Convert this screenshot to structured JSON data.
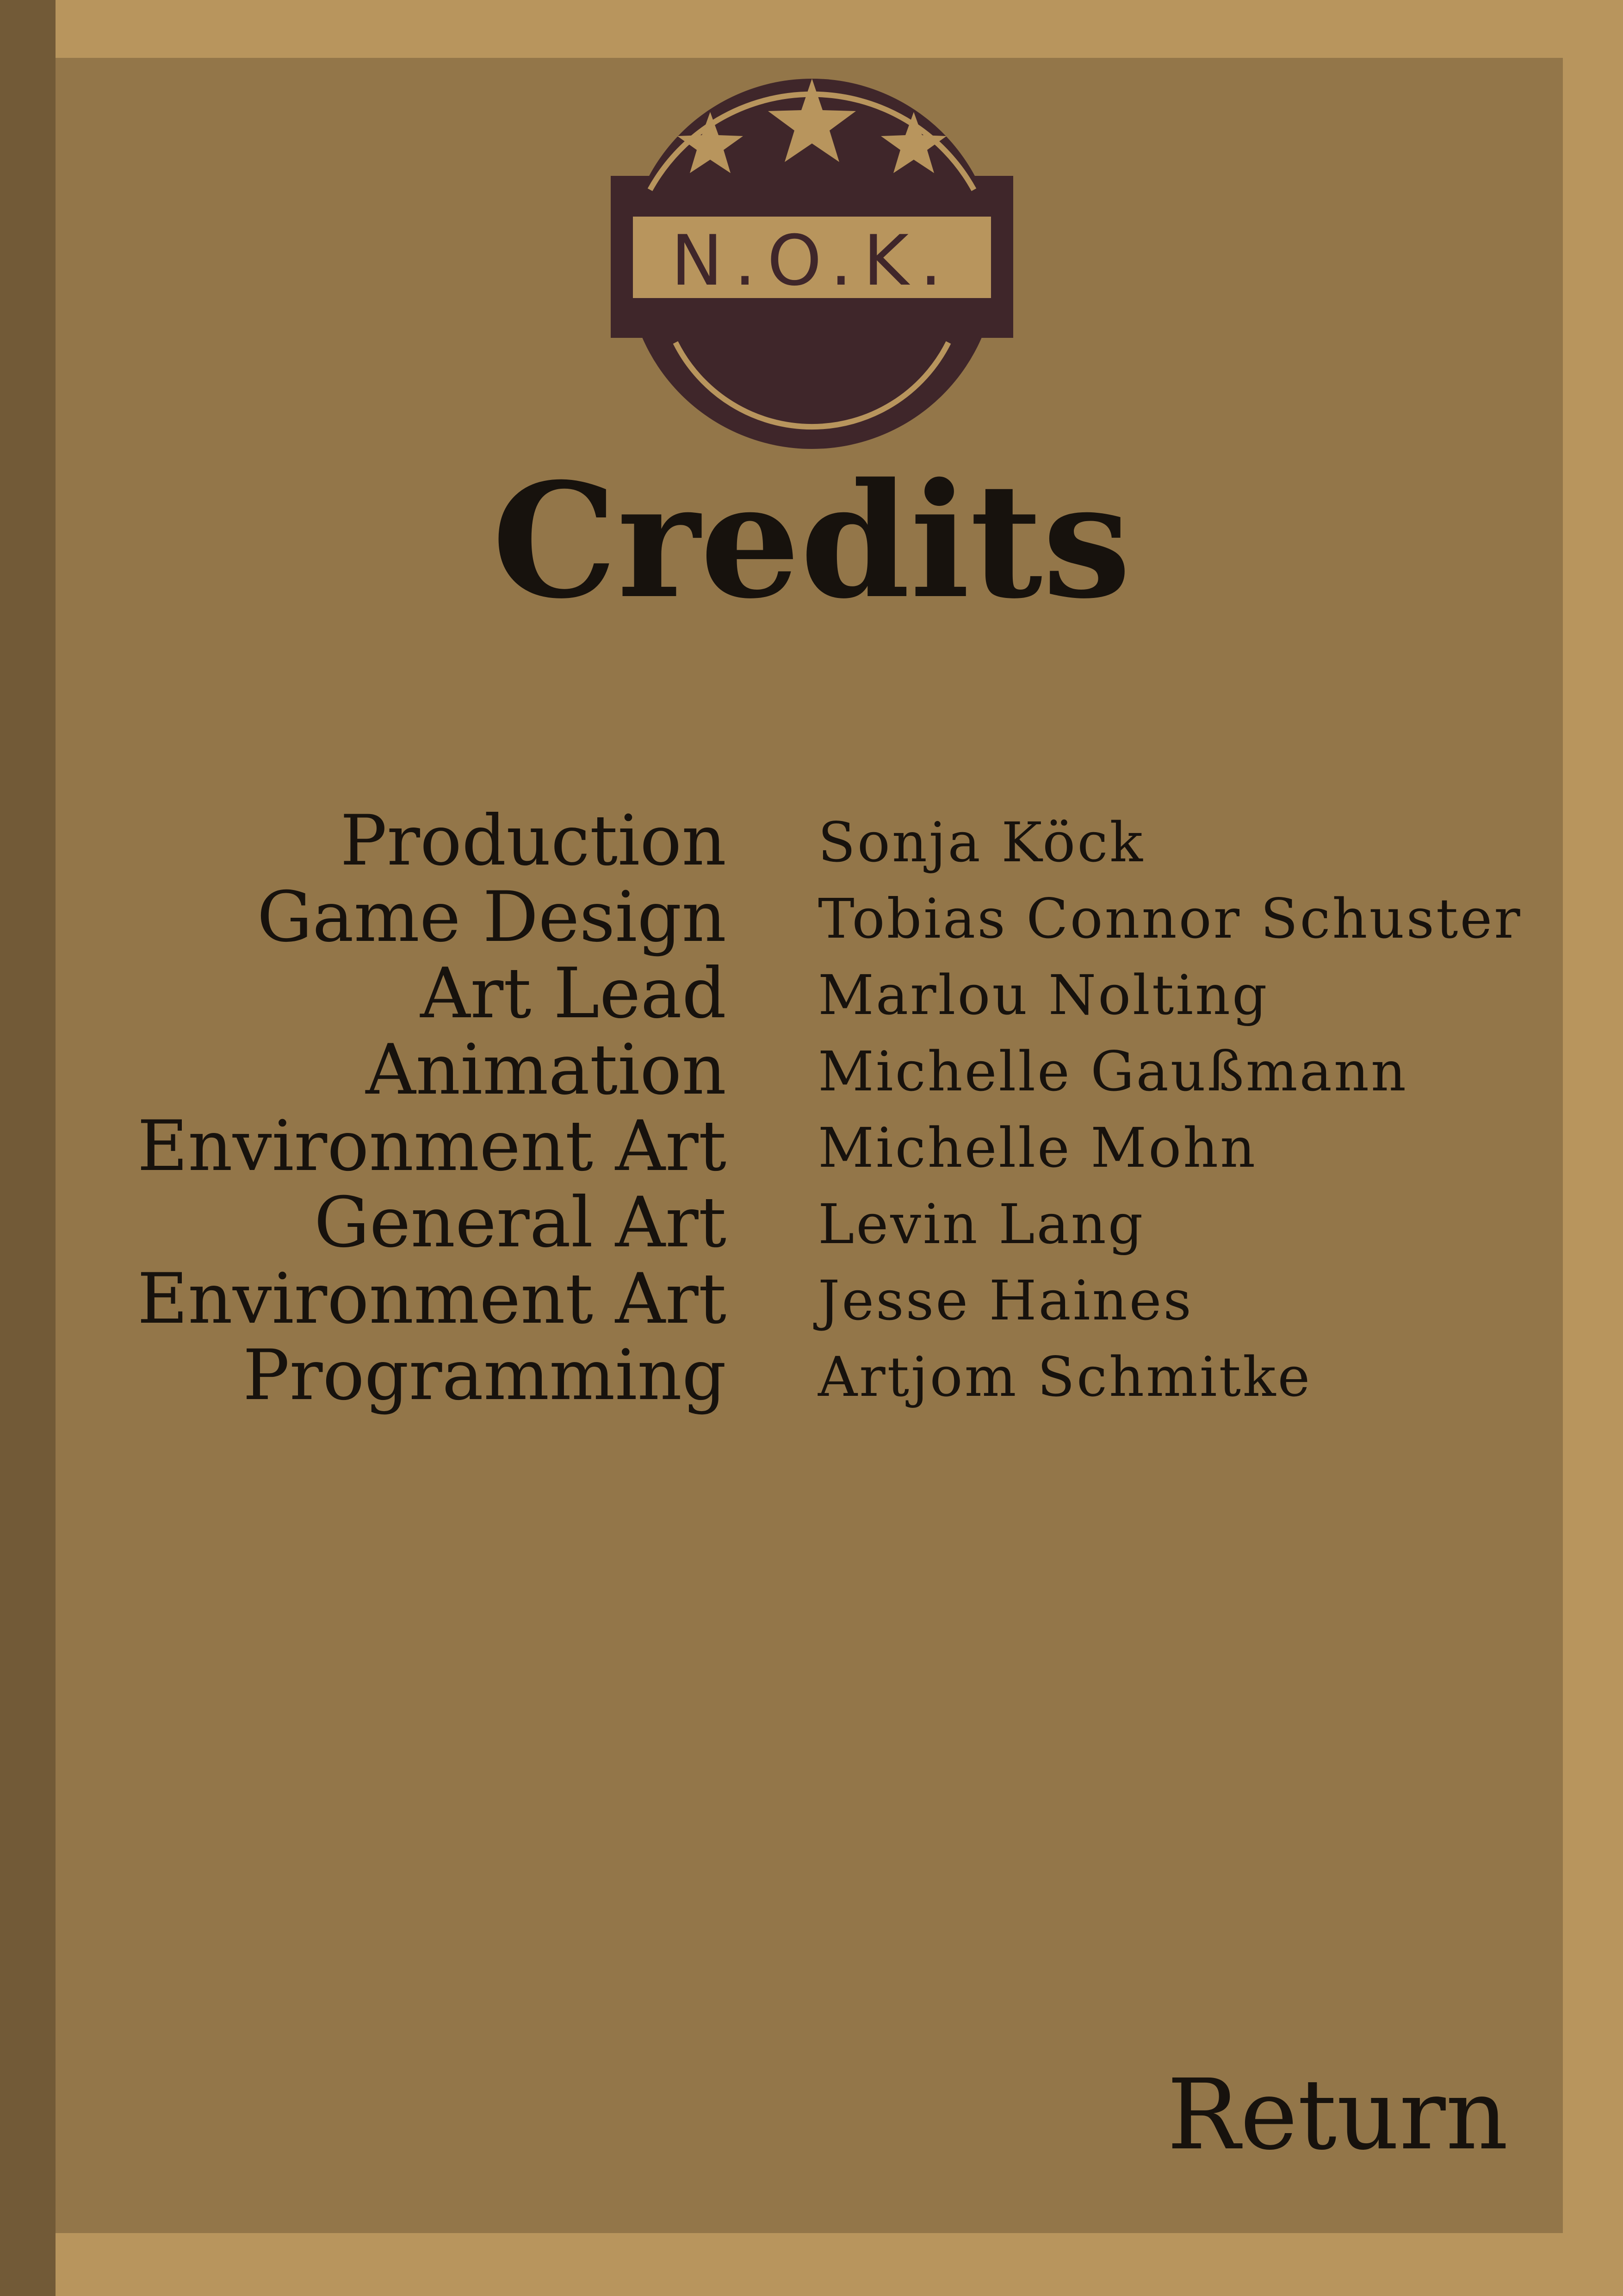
{
  "logo": {
    "text": "N.O.K."
  },
  "title": "Credits",
  "credits": [
    {
      "role": "Production",
      "name": "Sonja Köck"
    },
    {
      "role": "Game Design",
      "name": "Tobias Connor Schuster"
    },
    {
      "role": "Art Lead",
      "name": "Marlou Nolting"
    },
    {
      "role": "Animation",
      "name": "Michelle Gaußmann"
    },
    {
      "role": "Environment Art",
      "name": "Michelle Mohn"
    },
    {
      "role": "General Art",
      "name": "Levin Lang"
    },
    {
      "role": "Environment Art",
      "name": "Jesse Haines"
    },
    {
      "role": "Programming",
      "name": "Artjom Schmitke"
    }
  ],
  "return_label": "Return",
  "colors": {
    "frame": "#b8955d",
    "panel": "#937649",
    "left_strip": "#725a37",
    "text": "#17120d",
    "emblem": "#3f262a"
  }
}
